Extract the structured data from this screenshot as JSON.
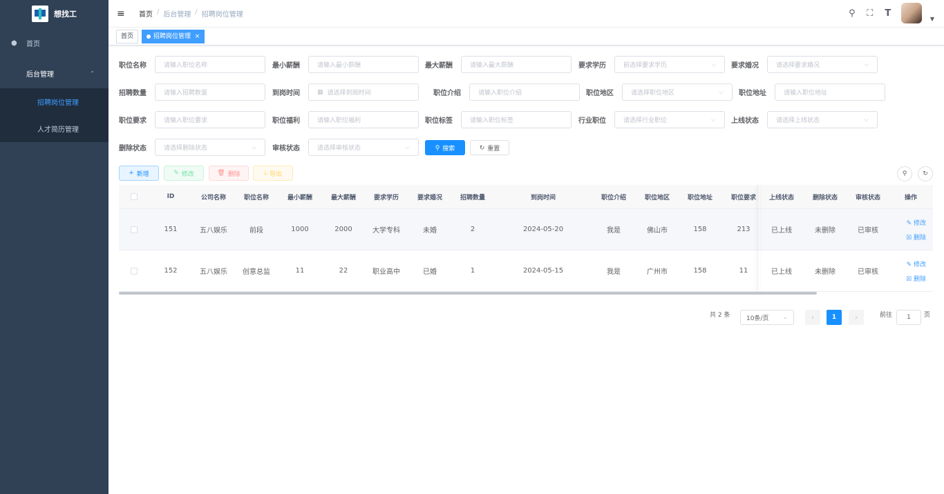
{
  "sidebar": {
    "logo_title": "想找工",
    "home": "首页",
    "group": "后台管理",
    "items": [
      "招聘岗位管理",
      "人才简历管理"
    ]
  },
  "header": {
    "breadcrumb": [
      "首页",
      "后台管理",
      "招聘岗位管理"
    ],
    "separator": "/",
    "icons": [
      "search-icon",
      "fullscreen-icon",
      "font-size-icon",
      "avatar"
    ]
  },
  "tags": {
    "home": "首页",
    "active": "招聘岗位管理",
    "close": "×"
  },
  "form": {
    "fields": [
      {
        "label": "职位名称",
        "placeholder": "请输入职位名称",
        "type": "input"
      },
      {
        "label": "最小薪酬",
        "placeholder": "请输入最小薪酬",
        "type": "input"
      },
      {
        "label": "最大薪酬",
        "placeholder": "请输入最大薪酬",
        "type": "input"
      },
      {
        "label": "要求学历",
        "placeholder": "前选择要求学历",
        "type": "select"
      },
      {
        "label": "要求婚况",
        "placeholder": "请选择要求婚况",
        "type": "select"
      },
      {
        "label": "招聘数量",
        "placeholder": "请输入招聘数量",
        "type": "input"
      },
      {
        "label": "到岗时间",
        "placeholder": "请选择到岗时间",
        "type": "date"
      },
      {
        "label": "职位介绍",
        "placeholder": "请输入职位介绍",
        "type": "input"
      },
      {
        "label": "职位地区",
        "placeholder": "请选择职位地区",
        "type": "select"
      },
      {
        "label": "职位地址",
        "placeholder": "请输入职位地址",
        "type": "input"
      },
      {
        "label": "职位要求",
        "placeholder": "请输入职位要求",
        "type": "input"
      },
      {
        "label": "职位福利",
        "placeholder": "请输入职位福利",
        "type": "input"
      },
      {
        "label": "职位标签",
        "placeholder": "请输入职位标签",
        "type": "input"
      },
      {
        "label": "行业职位",
        "placeholder": "请选择行业职位",
        "type": "select"
      },
      {
        "label": "上线状态",
        "placeholder": "请选择上线状态",
        "type": "select"
      },
      {
        "label": "删除状态",
        "placeholder": "请选择删除状态",
        "type": "select"
      },
      {
        "label": "审核状态",
        "placeholder": "请选择审核状态",
        "type": "select"
      }
    ],
    "search": "搜索",
    "reset": "重置"
  },
  "toolbar": {
    "add": "新增",
    "edit": "修改",
    "delete": "删除",
    "export": "导出"
  },
  "table": {
    "columns": [
      "ID",
      "公司名称",
      "职位名称",
      "最小薪酬",
      "最大薪酬",
      "要求学历",
      "要求婚况",
      "招聘数量",
      "到岗时间",
      "职位介绍",
      "职位地区",
      "职位地址",
      "职位要求",
      "上线状态",
      "删除状态",
      "审核状态",
      "操作"
    ],
    "rows": [
      [
        "151",
        "五八娱乐",
        "前段",
        "1000",
        "2000",
        "大学专科",
        "未婚",
        "2",
        "2024-05-20",
        "我是",
        "佛山市",
        "158",
        "213",
        "已上线",
        "未删除",
        "已审核"
      ],
      [
        "152",
        "五八娱乐",
        "创意总监",
        "11",
        "22",
        "职业高中",
        "已婚",
        "1",
        "2024-05-15",
        "我是",
        "广州市",
        "158",
        "11",
        "已上线",
        "未删除",
        "已审核"
      ]
    ],
    "row_edit": "修改",
    "row_delete": "删除"
  },
  "pagination": {
    "total": "共 2 条",
    "page_size": "10条/页",
    "current": "1",
    "goto": "前往",
    "goto_value": "1",
    "page_unit": "页"
  }
}
